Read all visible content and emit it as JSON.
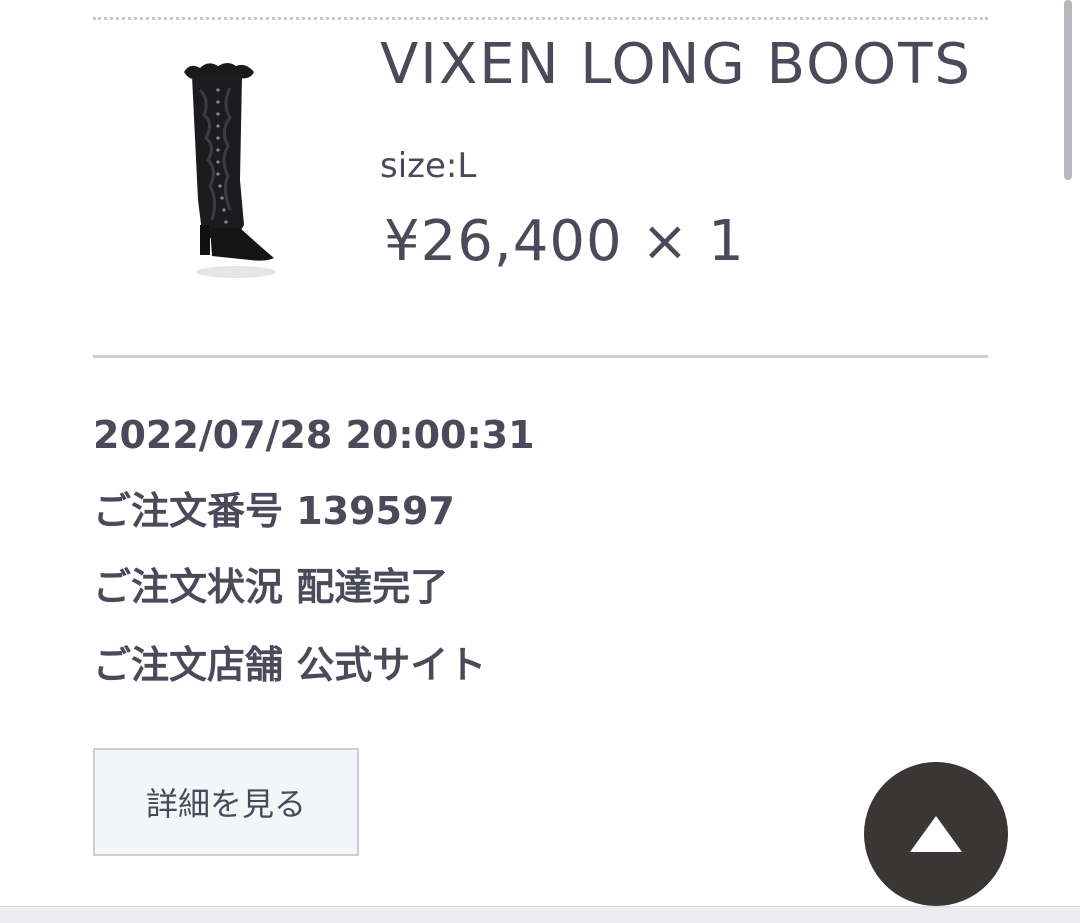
{
  "product": {
    "name": "VIXEN LONG BOOTS",
    "size": "size:L",
    "price": "¥26,400 × 1",
    "image_icon": "black-lace-long-boot"
  },
  "order": {
    "datetime": "2022/07/28 20:00:31",
    "number_line": "ご注文番号 139597",
    "status_line": "ご注文状況 配達完了",
    "store_line": "ご注文店舗 公式サイト"
  },
  "actions": {
    "detail_label": "詳細を見る",
    "scroll_top_icon": "triangle-up-icon"
  },
  "colors": {
    "text": "#4a4a5a",
    "button_bg": "#f4f5f8",
    "fab_bg": "#3a3636"
  }
}
